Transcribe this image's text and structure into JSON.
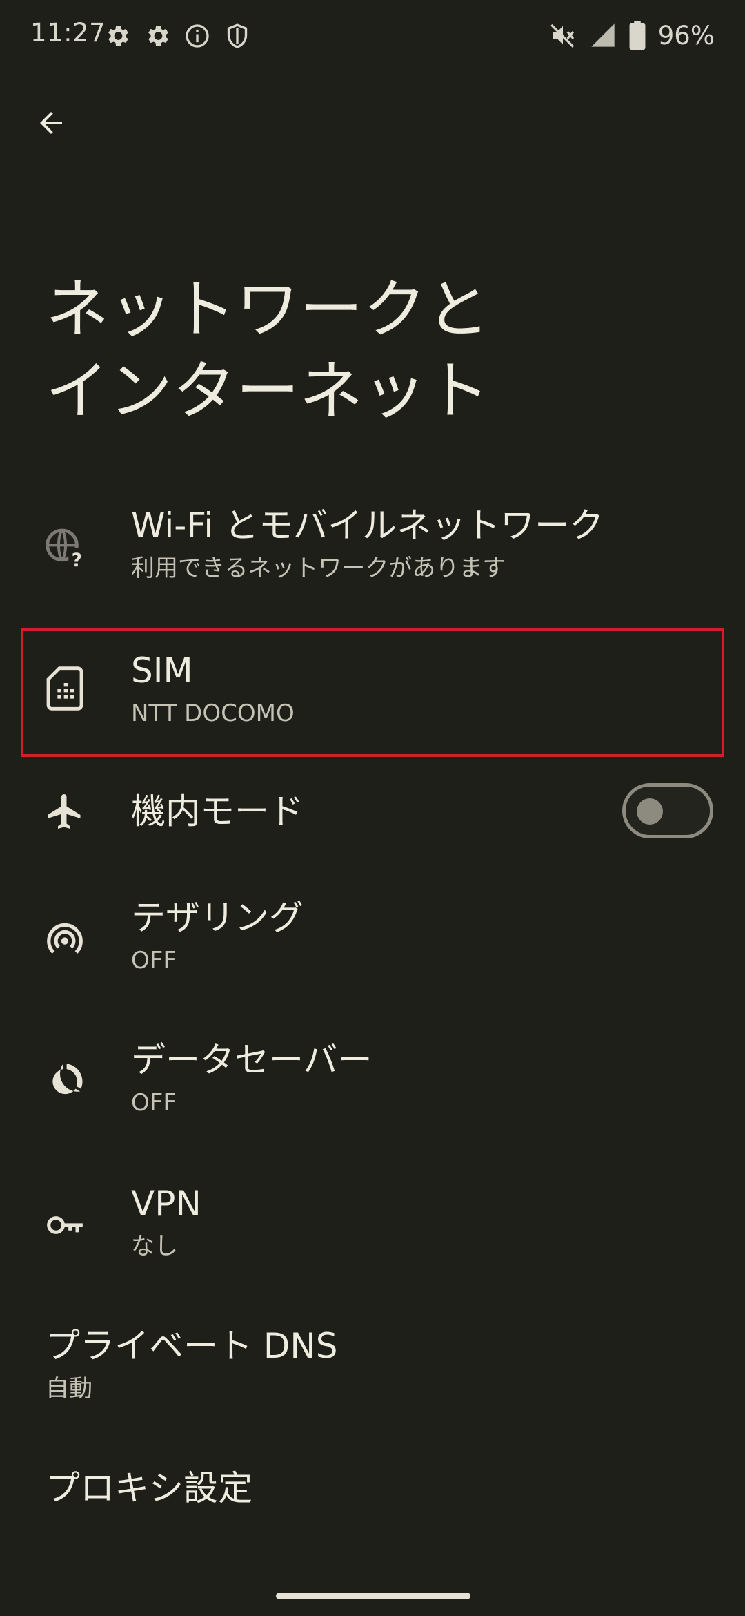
{
  "status_bar": {
    "time": "11:27",
    "battery_percent": "96%",
    "left_icons": [
      "gear-icon",
      "gear-icon",
      "info-icon",
      "shield-icon"
    ],
    "right_icons": [
      "mute-icon",
      "signal-icon",
      "battery-icon"
    ]
  },
  "header": {
    "back_icon": "arrow-back-icon",
    "title_line1": "ネットワークと",
    "title_line2": "インターネット"
  },
  "items": [
    {
      "title": "Wi-Fi とモバイルネットワーク",
      "summary": "利用できるネットワークがあります",
      "icon": "globe-question-icon"
    },
    {
      "title": "SIM",
      "summary": "NTT DOCOMO",
      "icon": "sim-card-icon"
    },
    {
      "title": "機内モード",
      "icon": "airplane-icon",
      "toggle_on": false
    },
    {
      "title": "テザリング",
      "summary": "OFF",
      "icon": "hotspot-icon"
    },
    {
      "title": "データセーバー",
      "summary": "OFF",
      "icon": "data-saver-icon"
    },
    {
      "title": "VPN",
      "summary": "なし",
      "icon": "key-icon"
    },
    {
      "title": "プライベート DNS",
      "summary": "自動"
    },
    {
      "title": "プロキシ設定"
    }
  ],
  "colors": {
    "background": "#1f1f1a",
    "text_primary": "#eeebdf",
    "text_secondary": "#c5c2b6",
    "highlight": "#d21e2a"
  }
}
